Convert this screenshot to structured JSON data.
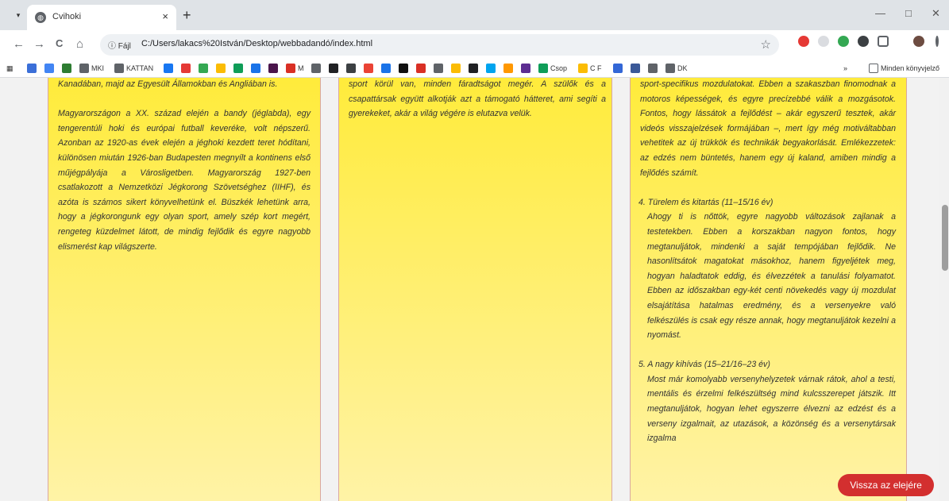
{
  "browser": {
    "tab_title": "Cvihoki",
    "tab_close": "×",
    "new_tab": "+",
    "window": {
      "minimize": "—",
      "maximize": "□",
      "close": "✕"
    },
    "nav": {
      "back": "←",
      "forward": "→",
      "reload": "C",
      "home": "⌂"
    },
    "address_scheme": "ⓘ Fájl",
    "address_url": "C:/Users/lakacs%20István/Desktop/webbadandó/index.html",
    "star": "☆",
    "bookmarks": [
      {
        "label": "",
        "color": "#3b6fd8"
      },
      {
        "label": "",
        "color": "#4285f4"
      },
      {
        "label": "",
        "color": "#2e7d32"
      },
      {
        "label": "MKI",
        "color": "#5f6368"
      },
      {
        "label": "KATTAN",
        "color": "#5f6368"
      },
      {
        "label": "",
        "color": "#1877f2"
      },
      {
        "label": "",
        "color": "#e53935"
      },
      {
        "label": "",
        "color": "#34a853"
      },
      {
        "label": "",
        "color": "#fbbc04"
      },
      {
        "label": "",
        "color": "#0f9d58"
      },
      {
        "label": "",
        "color": "#1a73e8"
      },
      {
        "label": "",
        "color": "#4a154b"
      },
      {
        "label": "M",
        "color": "#d93025"
      },
      {
        "label": "",
        "color": "#5f6368"
      },
      {
        "label": "",
        "color": "#202124"
      },
      {
        "label": "",
        "color": "#3c4043"
      },
      {
        "label": "",
        "color": "#ea4335"
      },
      {
        "label": "",
        "color": "#1a73e8"
      },
      {
        "label": "",
        "color": "#111"
      },
      {
        "label": "",
        "color": "#d93025"
      },
      {
        "label": "",
        "color": "#5f6368"
      },
      {
        "label": "",
        "color": "#fbbc04"
      },
      {
        "label": "",
        "color": "#202124"
      },
      {
        "label": "",
        "color": "#00a4ef"
      },
      {
        "label": "",
        "color": "#ff9800"
      },
      {
        "label": "",
        "color": "#5c2d91"
      },
      {
        "label": "Csop",
        "color": "#0f9d58"
      },
      {
        "label": "C F",
        "color": "#fbbc04"
      },
      {
        "label": "",
        "color": "#3367d6"
      },
      {
        "label": "",
        "color": "#3b5998"
      },
      {
        "label": "",
        "color": "#5f6368"
      },
      {
        "label": "DK",
        "color": "#5f6368"
      }
    ],
    "more_bookmarks": "»",
    "all_bookmarks": "Minden könyvjelző"
  },
  "page": {
    "col1": [
      "Kanadában, majd az Egyesült Államokban és Angliában is.",
      "Magyarországon a XX. század elején a bandy (jéglabda), egy tengerentúli hoki és európai futball keveréke, volt népszerű. Azonban az 1920-as évek elején a jéghoki kezdett teret hódítani, különösen miután 1926-ban Budapesten megnyílt a kontinens első műjégpályája a Városligetben. Magyarország 1927-ben csatlakozott a Nemzetközi Jégkorong Szövetséghez (IIHF), és azóta is számos sikert könyvelhetünk el. Büszkék lehetünk arra, hogy a jégkorongunk egy olyan sport, amely szép kort megért, rengeteg küzdelmet látott, de mindig fejlődik és egyre nagyobb elismerést kap világszerte."
    ],
    "col2": [
      "sport körül van, minden fáradtságot megér. A szülők és a csapattársak együtt alkotják azt a támogató hátteret, ami segíti a gyerekeket, akár a világ végére is elutazva velük."
    ],
    "col3": {
      "intro": "sport-specifikus mozdulatokat. Ebben a szakaszban finomodnak a motoros képességek, és egyre precízebbé válik a mozgásotok. Fontos, hogy lássátok a fejlődést – akár egyszerű tesztek, akár videós visszajelzések formájában –, mert így még motiváltabban vehetitek az új trükkök és technikák begyakorlását. Emlékezzetek: az edzés nem büntetés, hanem egy új kaland, amiben mindig a fejlődés számít.",
      "item4_title": "4. Türelem és kitartás (11–15/16 év)",
      "item4_body": "Ahogy ti is nőttök, egyre nagyobb változások zajlanak a testetekben. Ebben a korszakban nagyon fontos, hogy megtanuljátok, mindenki a saját tempójában fejlődik. Ne hasonlítsátok magatokat másokhoz, hanem figyeljétek meg, hogyan haladtatok eddig, és élvezzétek a tanulási folyamatot. Ebben az időszakban egy-két centi növekedés vagy új mozdulat elsajátítása hatalmas eredmény, és a versenyekre való felkészülés is csak egy része annak, hogy megtanuljátok kezelni a nyomást.",
      "item5_title": "5. A nagy kihívás (15–21/16–23 év)",
      "item5_body": "Most már komolyabb versenyhelyzetek várnak rátok, ahol a testi, mentális és érzelmi felkészültség mind kulcsszerepet játszik. Itt megtanuljátok, hogyan lehet egyszerre élvezni az edzést és a verseny izgalmait, az utazások, a közönség és a versenytársak izgalma"
    },
    "back_to_top": "Vissza az elejére"
  }
}
